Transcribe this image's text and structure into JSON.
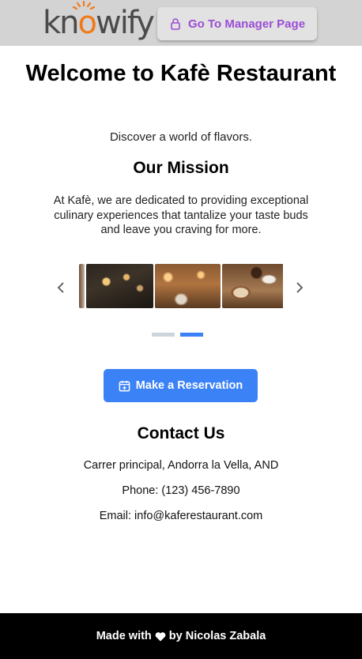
{
  "header": {
    "logo_text": "knowify",
    "manager_button_label": "Go To Manager Page",
    "manager_icon": "lock-icon"
  },
  "hero": {
    "title": "Welcome to Kafè Restaurant",
    "tagline": "Discover a world of flavors."
  },
  "mission": {
    "heading": "Our Mission",
    "text": "At Kafè, we are dedicated to providing exceptional culinary experiences that tantalize your taste buds and leave you craving for more."
  },
  "carousel": {
    "prev_icon": "chevron-left-icon",
    "next_icon": "chevron-right-icon",
    "slides": [
      "restaurant-interior-image",
      "cafe-bar-image",
      "latte-and-dessert-image"
    ],
    "active_dot": 1
  },
  "reservation": {
    "button_label": "Make a Reservation",
    "icon": "calendar-icon"
  },
  "contact": {
    "heading": "Contact Us",
    "address": "Carrer principal, Andorra la Vella, AND",
    "phone": "Phone: (123) 456-7890",
    "email": "Email: info@kaferestaurant.com"
  },
  "footer": {
    "made_with": "Made with",
    "by": "by Nicolas Zabala",
    "icon": "heart-icon"
  },
  "colors": {
    "header_bg": "#d3d3d3",
    "manager_text": "#9b4dd6",
    "accent": "#3b82f6",
    "footer_bg": "#000000",
    "logo_o": "#f07a1a"
  }
}
